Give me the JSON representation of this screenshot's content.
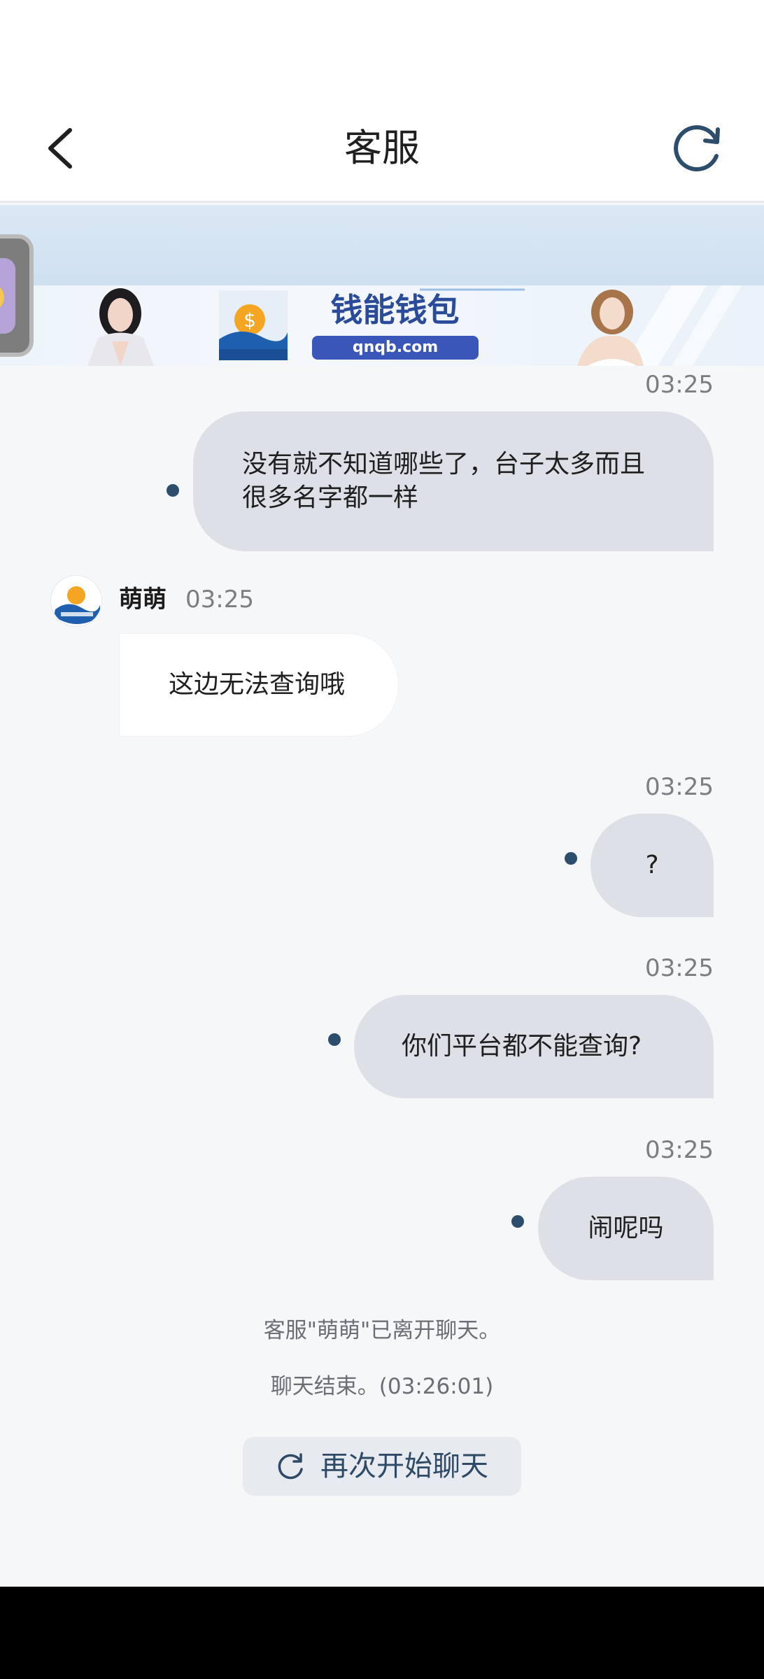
{
  "header": {
    "title": "客服"
  },
  "banner": {
    "brand": "钱能钱包",
    "url": "qnqb.com",
    "logo_caption": "钱能钱包"
  },
  "messages": {
    "m1": {
      "time": "03:25",
      "text_line1": "没有就不知道哪些了，台子太多而且",
      "text_line2": "很多名字都一样"
    },
    "agent": {
      "name": "萌萌",
      "time": "03:25",
      "text": "这边无法查询哦"
    },
    "m2": {
      "time": "03:25",
      "text": "?"
    },
    "m3": {
      "time": "03:25",
      "text": "你们平台都不能查询?"
    },
    "m4": {
      "time": "03:25",
      "text": "闹呢吗"
    }
  },
  "system": {
    "left_notice": "客服\"萌萌\"已离开聊天。",
    "ended_notice": "聊天结束。(03:26:01)"
  },
  "restart": {
    "label": "再次开始聊天"
  },
  "colors": {
    "accent": "#2d4d6c",
    "user_bubble": "#dde1e7",
    "background": "#f5f7f9"
  }
}
